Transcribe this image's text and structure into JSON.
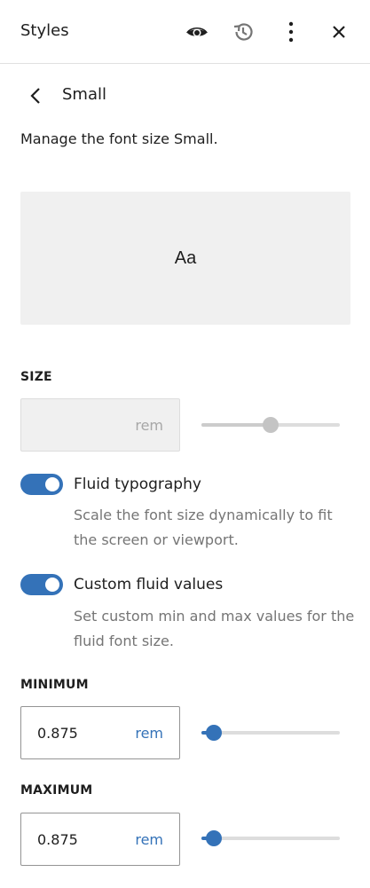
{
  "header": {
    "title": "Styles",
    "icons": [
      "eye-icon",
      "history-icon",
      "more-vertical-icon",
      "close-icon"
    ]
  },
  "nav": {
    "back_icon": "chevron-left-icon",
    "title": "Small"
  },
  "description": "Manage the font size Small.",
  "preview": {
    "text": "Aa"
  },
  "size": {
    "label": "SIZE",
    "value": "",
    "unit": "rem",
    "slider_fraction": 0.5
  },
  "fluid_typography": {
    "label": "Fluid typography",
    "enabled": true,
    "help": "Scale the font size dynamically to fit the screen or viewport."
  },
  "custom_fluid": {
    "label": "Custom fluid values",
    "enabled": true,
    "help": "Set custom min and max values for the fluid font size."
  },
  "minimum": {
    "label": "MINIMUM",
    "value": "0.875",
    "unit": "rem",
    "slider_fraction": 0.09
  },
  "maximum": {
    "label": "MAXIMUM",
    "value": "0.875",
    "unit": "rem",
    "slider_fraction": 0.09
  },
  "colors": {
    "accent": "#3472b8",
    "text": "#1e1e1e",
    "muted": "#757575",
    "preview_bg": "#f0f0f0"
  }
}
